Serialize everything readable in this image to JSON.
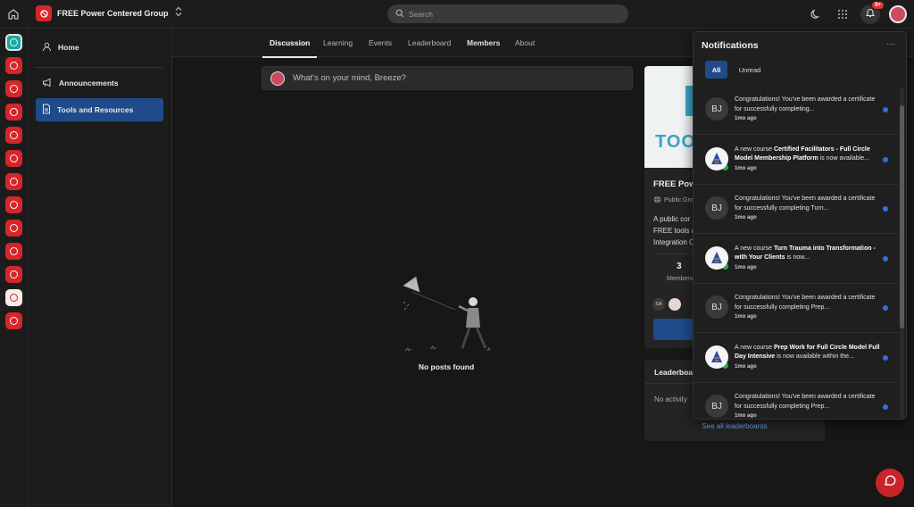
{
  "header": {
    "group_name": "FREE Power Centered Group",
    "search_placeholder": "Search",
    "notification_count": "9+"
  },
  "sidebar": {
    "items": [
      {
        "label": "Home",
        "icon": "user-icon"
      },
      {
        "label": "Announcements",
        "icon": "megaphone-icon"
      },
      {
        "label": "Tools and Resources",
        "icon": "document-icon",
        "active": true
      }
    ]
  },
  "tabs": [
    {
      "label": "Discussion",
      "active": true
    },
    {
      "label": "Learning"
    },
    {
      "label": "Events"
    },
    {
      "label": "Leaderboard"
    },
    {
      "label": "Members"
    },
    {
      "label": "About"
    }
  ],
  "feed": {
    "composer_placeholder": "What's on your mind, Breeze?",
    "empty_text": "No posts found"
  },
  "about_card": {
    "banner_text": "TOOL",
    "title": "FREE Powe",
    "type": "Public Gro",
    "description_lines": [
      "A public cor",
      "FREE tools a",
      "Integration C"
    ],
    "member_count": "3",
    "member_label": "Members",
    "member_avatars": [
      "SA",
      ""
    ]
  },
  "leaderboard_card": {
    "title": "Leaderboar",
    "empty_text": "No activity",
    "link": "See all leaderboards"
  },
  "notifications": {
    "title": "Notifications",
    "more": "···",
    "filters": {
      "all": "All",
      "unread": "Unread"
    },
    "items": [
      {
        "avatar": "BJ",
        "text_pre": "Congratulations! You've been awarded a certificate for successfully completing...",
        "bold": "",
        "text_post": "",
        "time": "1mo ago"
      },
      {
        "avatar": "",
        "text_pre": "A new course ",
        "bold": "Certified Facilitators - Full Circle Model Membership Platform",
        "text_post": " is now available...",
        "time": "1mo ago"
      },
      {
        "avatar": "BJ",
        "text_pre": "Congratulations! You've been awarded a certificate for successfully completing Turn...",
        "bold": "",
        "text_post": "",
        "time": "1mo ago"
      },
      {
        "avatar": "",
        "text_pre": "A new course ",
        "bold": "Turn Trauma into Transformation - with Your Clients",
        "text_post": " is now...",
        "time": "1mo ago"
      },
      {
        "avatar": "BJ",
        "text_pre": "Congratulations! You've been awarded a certificate for successfully completing Prep...",
        "bold": "",
        "text_post": "",
        "time": "1mo ago"
      },
      {
        "avatar": "",
        "text_pre": "A new course ",
        "bold": "Prep Work for Full Circle Model Full Day Intensive",
        "text_post": " is now available within the...",
        "time": "1mo ago"
      },
      {
        "avatar": "BJ",
        "text_pre": "Congratulations! You've been awarded a certificate for successfully completing Prep...",
        "bold": "",
        "text_post": "",
        "time": "1mo ago"
      }
    ]
  },
  "colors": {
    "accent": "#1f4b8a",
    "brand": "#d6262b",
    "unread_dot": "#2f6fe0",
    "badge": "#d83a32"
  }
}
